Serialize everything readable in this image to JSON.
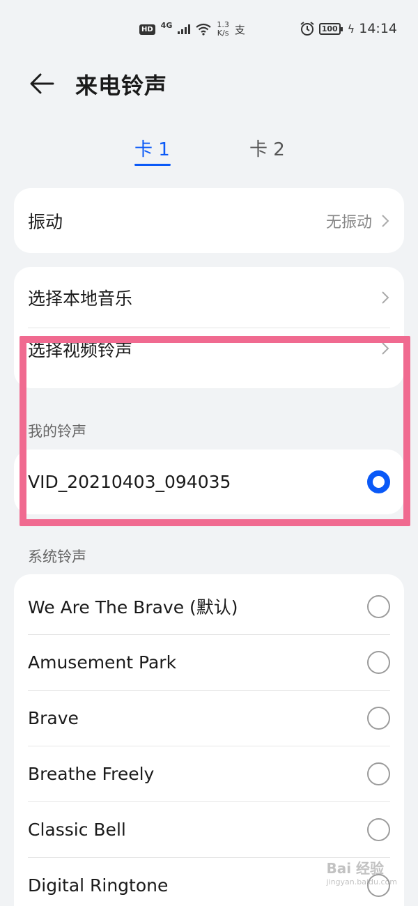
{
  "status_bar": {
    "hd": "HD",
    "network": "4G",
    "speed_value": "1.3",
    "speed_unit": "K/s",
    "alipay_icon": "支",
    "battery": "100",
    "time": "14:14"
  },
  "header": {
    "title": "来电铃声"
  },
  "tabs": [
    {
      "label": "卡 1",
      "active": true
    },
    {
      "label": "卡 2",
      "active": false
    }
  ],
  "vibration": {
    "label": "振动",
    "value": "无振动"
  },
  "options": {
    "local_music": "选择本地音乐",
    "video_ringtone": "选择视频铃声"
  },
  "my_ringtones": {
    "title": "我的铃声",
    "items": [
      {
        "label": "VID_20210403_094035",
        "selected": true
      }
    ]
  },
  "system_ringtones": {
    "title": "系统铃声",
    "items": [
      {
        "label": "We Are The Brave (默认)",
        "selected": false
      },
      {
        "label": "Amusement Park",
        "selected": false
      },
      {
        "label": "Brave",
        "selected": false
      },
      {
        "label": "Breathe Freely",
        "selected": false
      },
      {
        "label": "Classic Bell",
        "selected": false
      },
      {
        "label": "Digital Ringtone",
        "selected": false
      }
    ]
  },
  "watermark": {
    "text": "Bai 经验",
    "sub": "jingyan.baidu.com"
  },
  "colors": {
    "accent": "#0a59f7",
    "highlight": "#f06a90",
    "background": "#f1f3f5"
  }
}
